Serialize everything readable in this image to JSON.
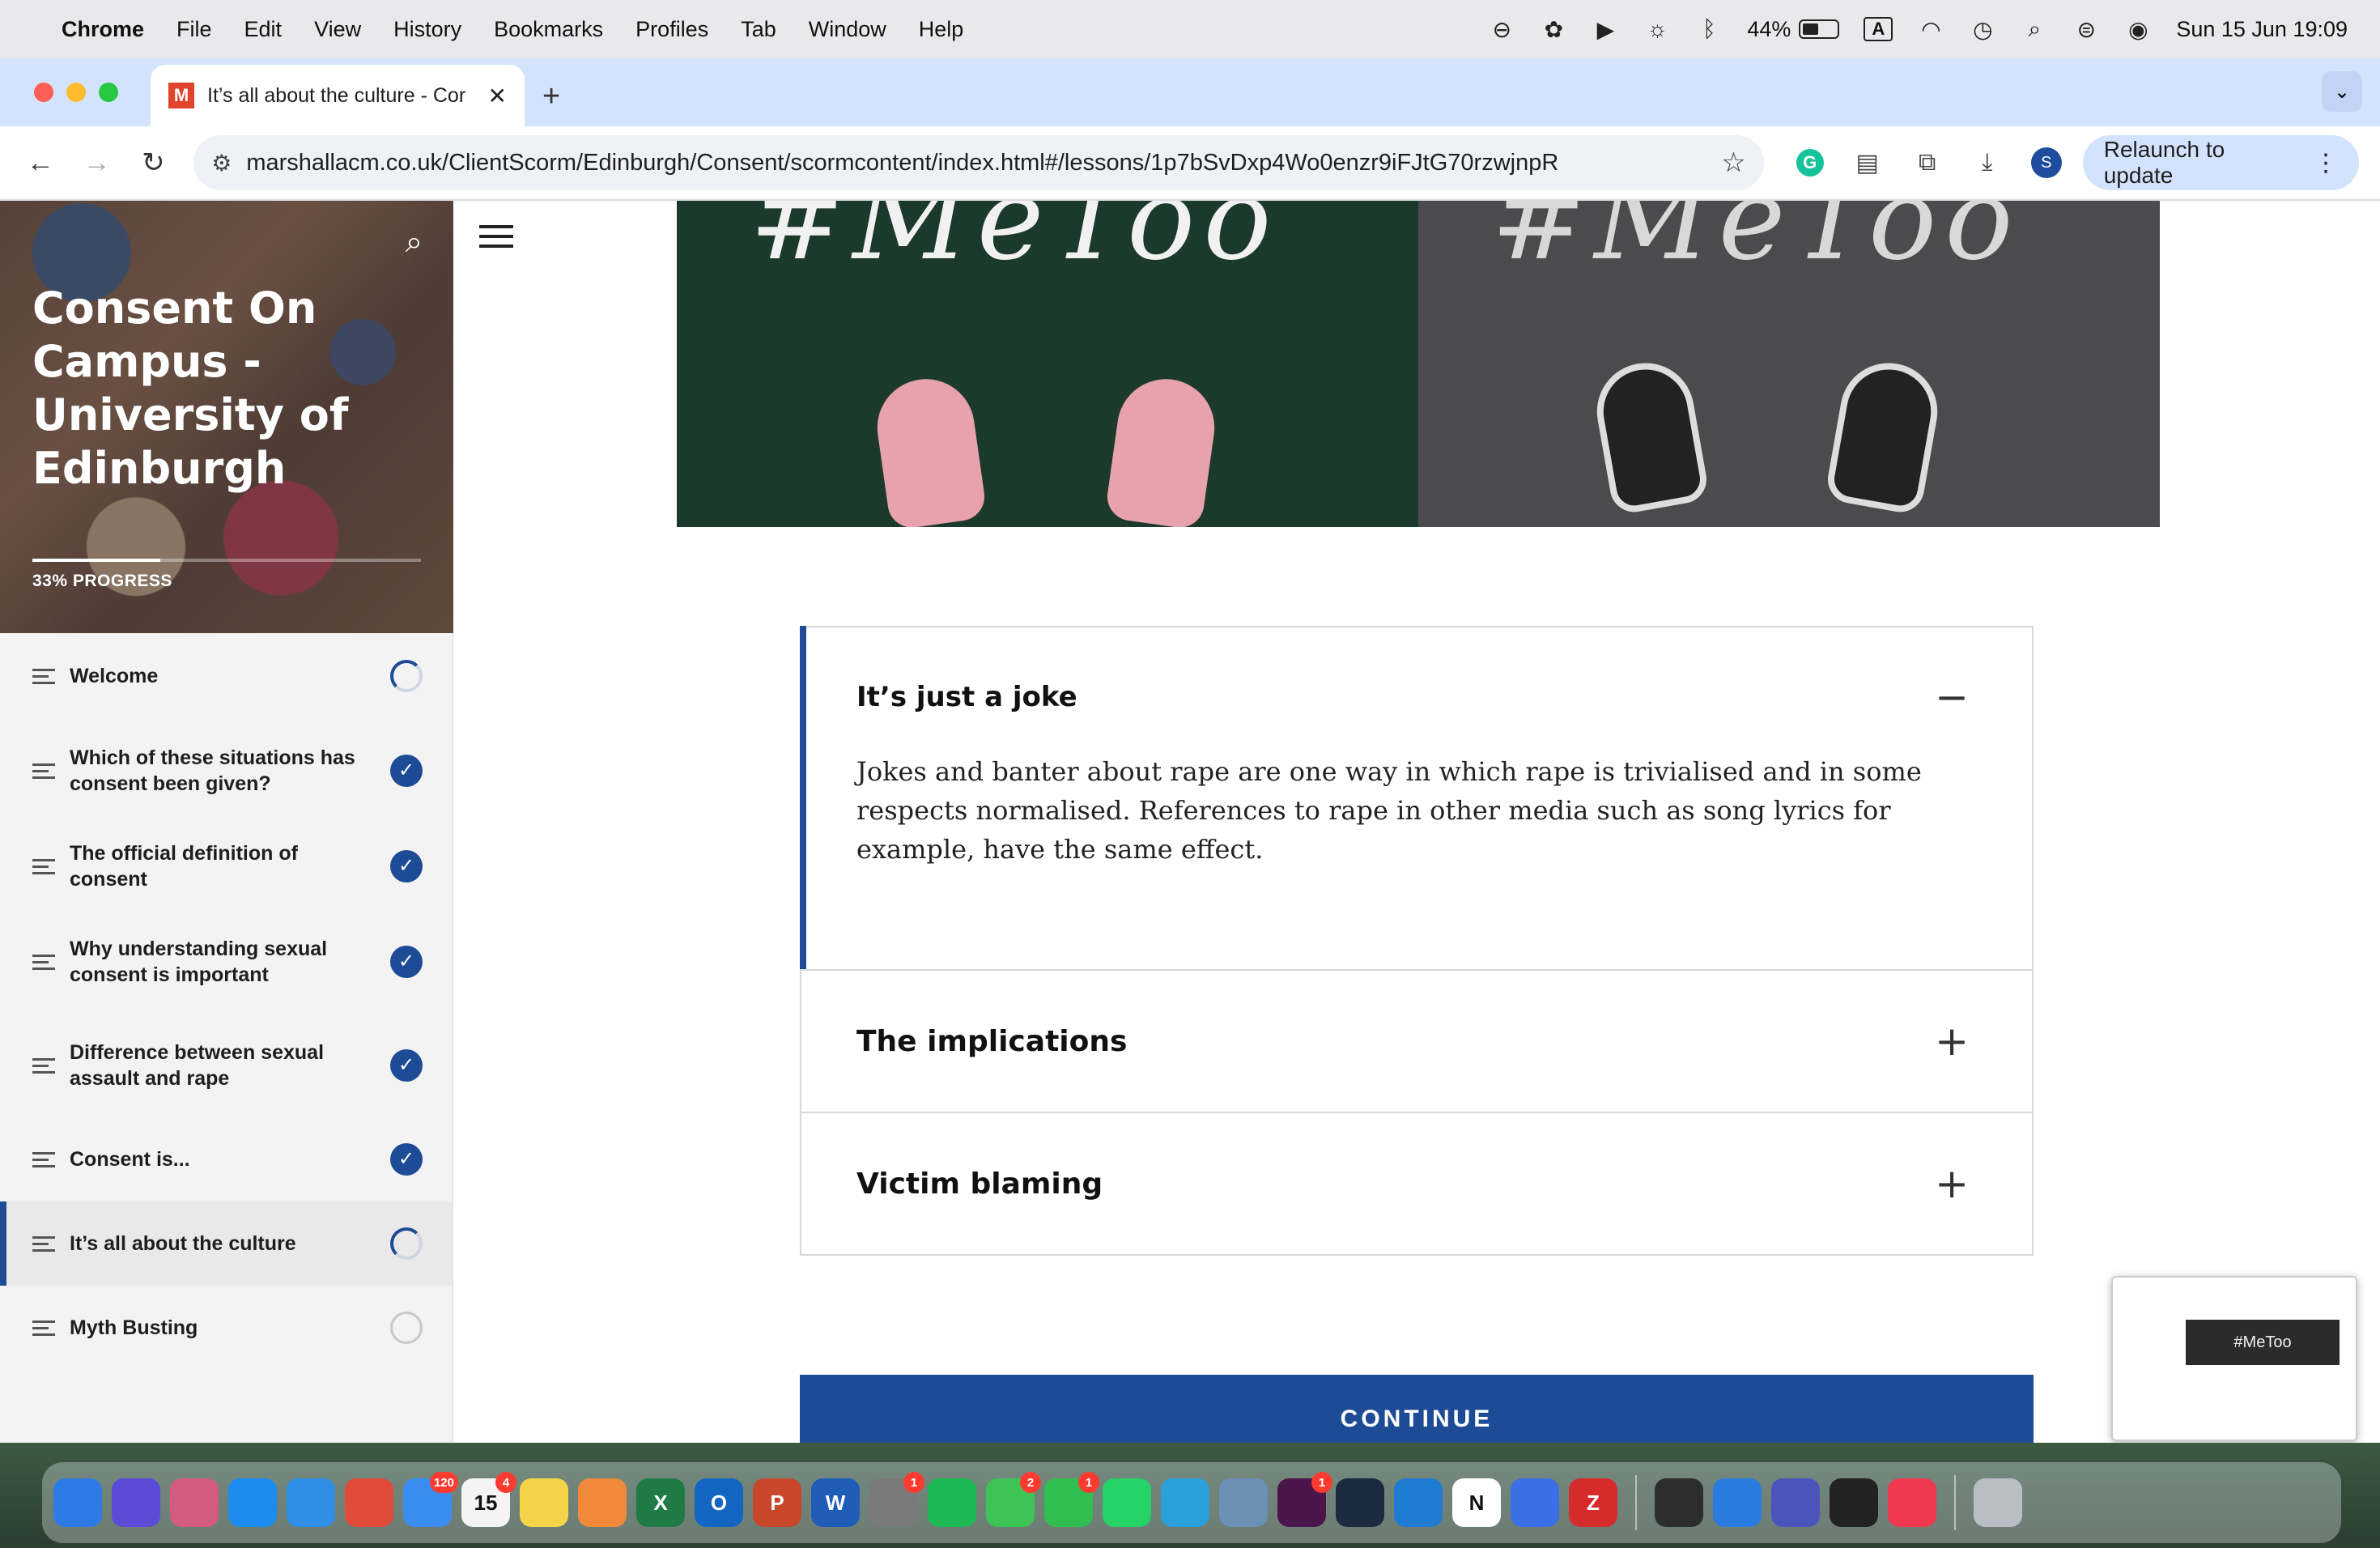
{
  "menubar": {
    "app_name": "Chrome",
    "items": [
      "File",
      "Edit",
      "View",
      "History",
      "Bookmarks",
      "Profiles",
      "Tab",
      "Window",
      "Help"
    ],
    "battery_percent": "44%",
    "keyboard_input": "A",
    "datetime": "Sun 15 Jun  19:09"
  },
  "browser": {
    "tab_title": "It’s all about the culture - Cor",
    "favicon_letter": "M",
    "url": "marshallacm.co.uk/ClientScorm/Edinburgh/Consent/scormcontent/index.html#/lessons/1p7bSvDxp4Wo0enzr9iFJtG70rzwjnpR",
    "profile_initial": "S",
    "relaunch_label": "Relaunch to update",
    "accent_color": "#d3e3fd"
  },
  "sidebar": {
    "course_title": "Consent On Campus - University of Edinburgh",
    "progress_text": "33% PROGRESS",
    "progress_fraction": 0.33,
    "lessons": [
      {
        "label": "Welcome",
        "status": "partial"
      },
      {
        "label": "Which of these situations has consent been given?",
        "status": "done"
      },
      {
        "label": "The official definition of consent",
        "status": "done"
      },
      {
        "label": "Why understanding sexual consent is important",
        "status": "done"
      },
      {
        "label": "Difference between sexual assault and rape",
        "status": "done"
      },
      {
        "label": "Consent is...",
        "status": "done"
      },
      {
        "label": "It’s all about the culture",
        "status": "partial",
        "active": true
      },
      {
        "label": "Myth Busting",
        "status": "empty"
      }
    ]
  },
  "hero": {
    "left_text": "#MeToo",
    "right_text": "#MeToo"
  },
  "accordion": {
    "items": [
      {
        "title": "It’s just a joke",
        "toggle": "−",
        "open": true,
        "body": "Jokes and banter about rape are one way in which rape is trivialised and in some respects normalised.  References to rape in other media such as song lyrics for example, have the same effect."
      },
      {
        "title": "The implications",
        "toggle": "+",
        "open": false
      },
      {
        "title": "Victim blaming",
        "toggle": "+",
        "open": false
      }
    ]
  },
  "continue_label": "CONTINUE",
  "theme": {
    "primary": "#1e4b95"
  },
  "dock": {
    "apps": [
      {
        "name": "Finder",
        "color": "#2f7be5"
      },
      {
        "name": "Siri",
        "color": "#5b4bd6"
      },
      {
        "name": "Launchpad",
        "color": "#d35b7f"
      },
      {
        "name": "App Store",
        "color": "#1c8cf0"
      },
      {
        "name": "Safari",
        "color": "#2f8ee6"
      },
      {
        "name": "Chrome",
        "color": "#e04b3a"
      },
      {
        "name": "Mail",
        "color": "#3a8ef0",
        "badge": "120"
      },
      {
        "name": "Calendar",
        "color": "#f4f4f4",
        "badge": "4",
        "text": "15"
      },
      {
        "name": "Notes",
        "color": "#f5d44a"
      },
      {
        "name": "Photos",
        "color": "#f08a3a"
      },
      {
        "name": "Excel",
        "color": "#1f7a45",
        "text": "X"
      },
      {
        "name": "Outlook",
        "color": "#1266c2",
        "text": "O"
      },
      {
        "name": "PowerPoint",
        "color": "#c8472a",
        "text": "P"
      },
      {
        "name": "Word",
        "color": "#1f5db8",
        "text": "W"
      },
      {
        "name": "System Settings",
        "color": "#7a7a7a",
        "badge": "1"
      },
      {
        "name": "Spotify",
        "color": "#1db954"
      },
      {
        "name": "Messages",
        "color": "#3ec454",
        "badge": "2"
      },
      {
        "name": "FaceTime",
        "color": "#2fbe4f",
        "badge": "1"
      },
      {
        "name": "WhatsApp",
        "color": "#25d366"
      },
      {
        "name": "Telegram",
        "color": "#2aa0da"
      },
      {
        "name": "Preview",
        "color": "#6b8fb5"
      },
      {
        "name": "Slack",
        "color": "#4a154b",
        "badge": "1"
      },
      {
        "name": "Cursor",
        "color": "#1b2a3e"
      },
      {
        "name": "VS Code",
        "color": "#1f7ad1"
      },
      {
        "name": "Notion",
        "color": "#ffffff",
        "text": "N"
      },
      {
        "name": "Arc",
        "color": "#3c6ee6"
      },
      {
        "name": "Zotero",
        "color": "#d62b2b",
        "text": "Z"
      },
      {
        "name": "ChatGPT",
        "color": "#2d2d2d"
      },
      {
        "name": "Keynote",
        "color": "#2a7be0"
      },
      {
        "name": "Teams",
        "color": "#4b53bc"
      },
      {
        "name": "Activity Monitor",
        "color": "#222222"
      },
      {
        "name": "Music",
        "color": "#f0384f"
      },
      {
        "name": "Trash",
        "color": "#b9bec4"
      }
    ]
  }
}
